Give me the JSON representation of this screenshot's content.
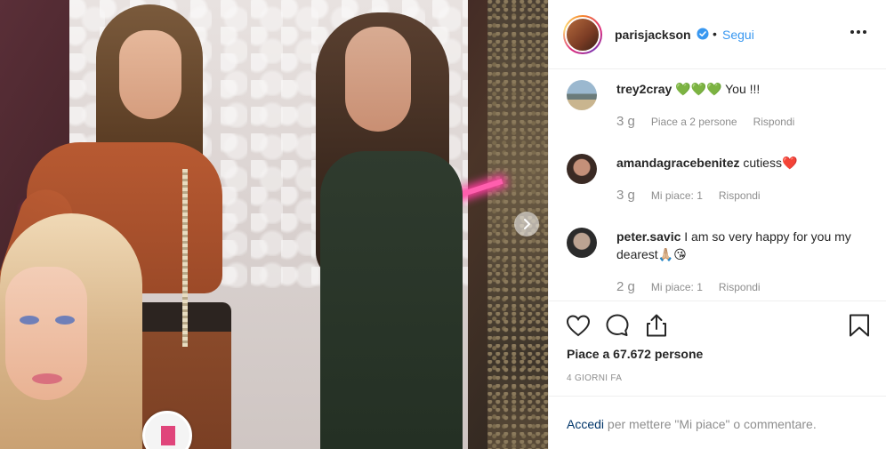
{
  "post": {
    "username": "parisjackson",
    "separator": "•",
    "follow_label": "Segui"
  },
  "comments": [
    {
      "username": "trey2cray",
      "text": "💚💚💚 You !!!",
      "time": "3 g",
      "likes_label": "Piace a 2 persone",
      "reply_label": "Rispondi"
    },
    {
      "username": "amandagracebenitez",
      "text": "cutiess❤️",
      "time": "3 g",
      "likes_label": "Mi piace: 1",
      "reply_label": "Rispondi"
    },
    {
      "username": "peter.savic",
      "text": "I am so very happy for you my dearest🙏🏼😘",
      "time": "2 g",
      "likes_label": "Mi piace: 1",
      "reply_label": "Rispondi"
    }
  ],
  "likes_count_label": "Piace a 67.672 persone",
  "post_age": "4 GIORNI FA",
  "login_prompt": {
    "link_label": "Accedi",
    "rest": " per mettere \"Mi piace\" o commentare."
  },
  "icons": {
    "like": "heart-icon",
    "comment": "comment-icon",
    "share": "share-icon",
    "save": "bookmark-icon",
    "more": "more-options-icon",
    "next": "chevron-right-icon",
    "verified": "verified-badge-icon"
  },
  "colors": {
    "link": "#3897f0",
    "verified": "#3897f0",
    "meta": "#8e8e8e",
    "text": "#262626"
  }
}
